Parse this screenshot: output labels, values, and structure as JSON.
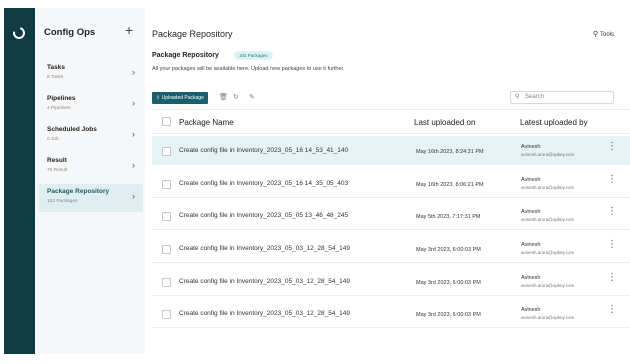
{
  "sidebar": {
    "title": "Config Ops",
    "add_icon": "plus-icon",
    "items": [
      {
        "label": "Tasks",
        "sub": "8 Tasks"
      },
      {
        "label": "Pipelines",
        "sub": "4 Pipelines"
      },
      {
        "label": "Scheduled Jobs",
        "sub": "0 Job"
      },
      {
        "label": "Result",
        "sub": "70 Result"
      },
      {
        "label": "Package Repository",
        "sub": "102 Packages"
      }
    ],
    "active_index": 4
  },
  "header": {
    "title": "Package Repository",
    "tools_label": "Tools"
  },
  "section": {
    "title": "Package Repository",
    "badge": "102 Packages",
    "description": "All your packages will be available here. Upload new packages to use it further."
  },
  "toolbar": {
    "upload_label": "Uploaded Package",
    "search_placeholder": "Search"
  },
  "table": {
    "columns": [
      "Package Name",
      "Last uploaded on",
      "Latest uploaded by"
    ],
    "rows": [
      {
        "name": "Create config file in Inventory_2023_05_16 14_53_41_140",
        "date": "May 16th 2023, 8:24:31 PM",
        "user": "Avinesh",
        "email": "avinesh.arora@opkey.com",
        "selected": true
      },
      {
        "name": "Create config file in Inventory_2023_05_16 14_35_05_403",
        "date": "May 16th 2023, 8:06:21 PM",
        "user": "Avinesh",
        "email": "avinesh.arora@opkey.com",
        "selected": false
      },
      {
        "name": "Create config file in Inventory_2023_05_05 13_46_48_245",
        "date": "May 5th 2023, 7:17:31 PM",
        "user": "Avinesh",
        "email": "avinesh.arora@opkey.com",
        "selected": false
      },
      {
        "name": "Create config file in Inventory_2023_05_03_12_28_54_149",
        "date": "May 3rd 2023, 6:00:03 PM",
        "user": "Avinesh",
        "email": "avinesh.arora@opkey.com",
        "selected": false
      },
      {
        "name": "Create config file in Inventory_2023_05_03_12_28_54_149",
        "date": "May 3rd 2023, 6:00:03 PM",
        "user": "Avinesh",
        "email": "avinesh.arora@opkey.com",
        "selected": false
      },
      {
        "name": "Create config file in Inventory_2023_05_03_12_28_54_149",
        "date": "May 3rd 2023, 6:00:03 PM",
        "user": "Avinesh",
        "email": "avinesh.arora@opkey.com",
        "selected": false
      }
    ]
  },
  "colors": {
    "rail": "#0f3c44",
    "accent": "#175f6a",
    "selected_row": "#e6f3f6"
  }
}
